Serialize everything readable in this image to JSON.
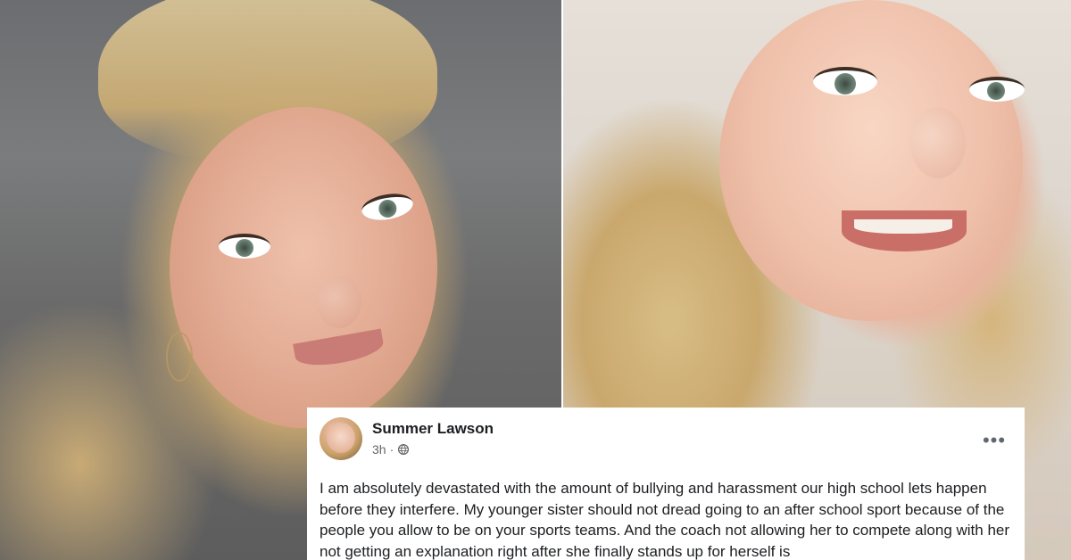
{
  "post": {
    "author": "Summer Lawson",
    "time": "3h",
    "separator": "·",
    "more_icon": "•••",
    "body": "I am absolutely devastated with the amount of bullying and harassment our high school lets happen before they interfere. My younger sister should not dread going to an after school sport because of the people you allow to be on your sports teams. And the coach not allowing her to compete along with her not getting an explanation right after she finally stands up for herself is"
  },
  "icons": {
    "privacy": "globe-icon",
    "more": "more-icon"
  },
  "colors": {
    "text_primary": "#1c1e21",
    "text_secondary": "#65676b",
    "card_background": "#ffffff"
  }
}
